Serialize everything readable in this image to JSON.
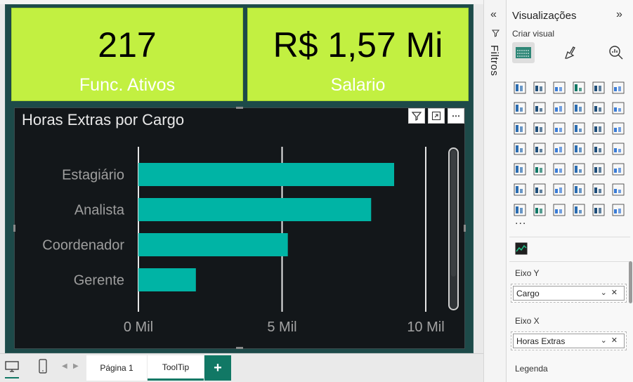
{
  "colors": {
    "card_bg": "#c2f041",
    "bar": "#00b4a5",
    "chart_bg": "#13171a",
    "canvas_bg": "#1d4a49",
    "accent": "#117865"
  },
  "cards": [
    {
      "value": "217",
      "label": "Func. Ativos"
    },
    {
      "value": "R$ 1,57 Mi",
      "label": "Salario"
    }
  ],
  "chart_data": {
    "type": "bar",
    "orientation": "horizontal",
    "title": "Horas Extras por Cargo",
    "categories": [
      "Estagiário",
      "Analista",
      "Coordenador",
      "Gerente"
    ],
    "values": [
      8.9,
      8.1,
      5.2,
      2.0
    ],
    "value_units": "Mil",
    "xticks": [
      "0 Mil",
      "5 Mil",
      "10 Mil"
    ],
    "xlim": [
      0,
      10
    ],
    "grid": true
  },
  "chart_tools": {
    "filter_icon": "funnel-icon",
    "focus_icon": "focus-mode-icon",
    "more_icon": "more-options-icon"
  },
  "tabs": [
    {
      "label": "Página 1",
      "active": false
    },
    {
      "label": "ToolTip",
      "active": true
    }
  ],
  "filters_pane": {
    "label": "Filtros"
  },
  "visualizations": {
    "title": "Visualizações",
    "subtitle": "Criar visual",
    "more": "...",
    "wells": [
      {
        "label": "Eixo Y",
        "field": "Cargo"
      },
      {
        "label": "Eixo X",
        "field": "Horas Extras"
      },
      {
        "label": "Legenda",
        "field": ""
      }
    ]
  }
}
